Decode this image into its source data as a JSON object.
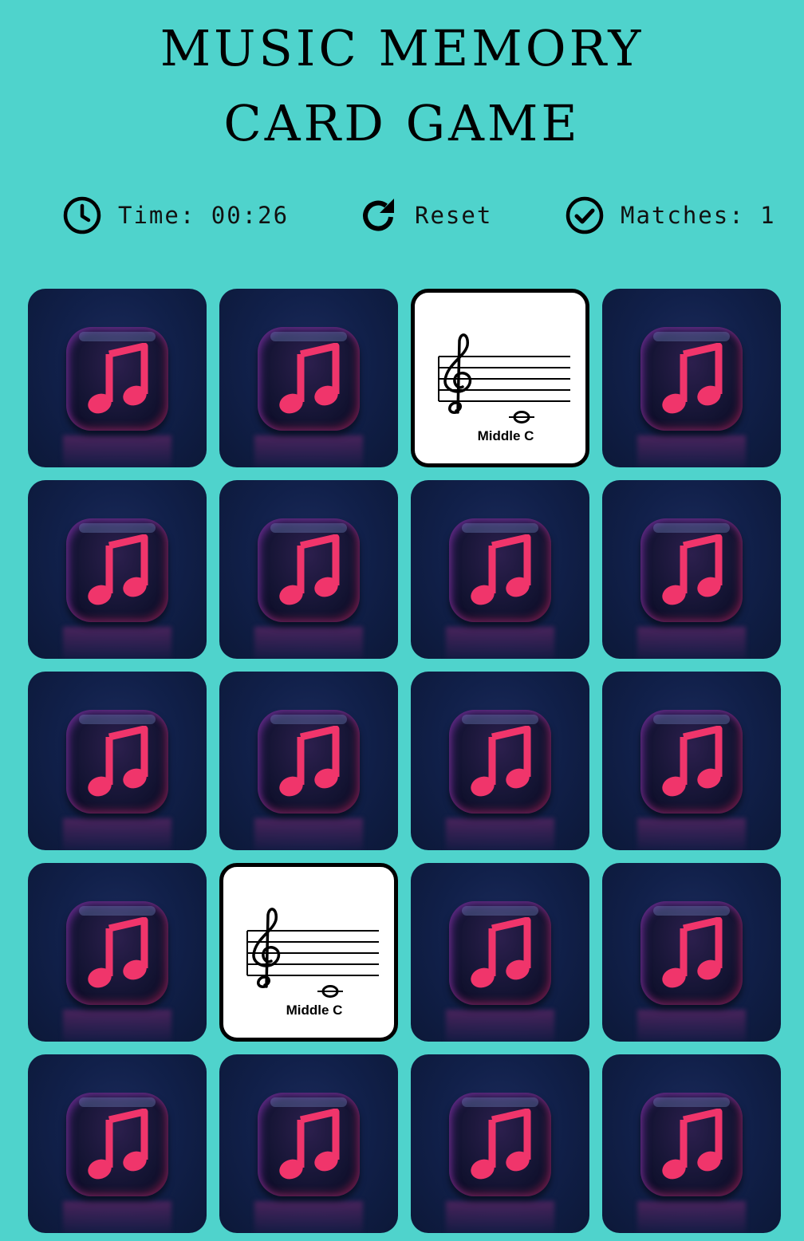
{
  "title": "MUSIC MEMORY CARD GAME",
  "stats": {
    "time_label": "Time: 00:26",
    "reset_label": "Reset",
    "matches_label": "Matches: 1",
    "icons": [
      "clock-icon",
      "reset-icon",
      "check-circle-icon"
    ]
  },
  "board": {
    "rows": 5,
    "columns": 4,
    "cards": [
      {
        "state": "hidden"
      },
      {
        "state": "hidden"
      },
      {
        "state": "open",
        "label": "Middle C"
      },
      {
        "state": "hidden"
      },
      {
        "state": "hidden"
      },
      {
        "state": "hidden"
      },
      {
        "state": "hidden"
      },
      {
        "state": "hidden"
      },
      {
        "state": "hidden"
      },
      {
        "state": "hidden"
      },
      {
        "state": "hidden"
      },
      {
        "state": "hidden"
      },
      {
        "state": "hidden"
      },
      {
        "state": "open",
        "label": "Middle C"
      },
      {
        "state": "hidden"
      },
      {
        "state": "hidden"
      },
      {
        "state": "hidden"
      },
      {
        "state": "hidden"
      },
      {
        "state": "hidden"
      },
      {
        "state": "hidden"
      }
    ],
    "card_back_icon": "music-note-icon",
    "card_face_icon": "treble-clef-staff-icon"
  },
  "colors": {
    "background": "#4fd3cc",
    "card_back": "#11204a",
    "note": "#f0356b",
    "open_card_border": "#000000"
  }
}
